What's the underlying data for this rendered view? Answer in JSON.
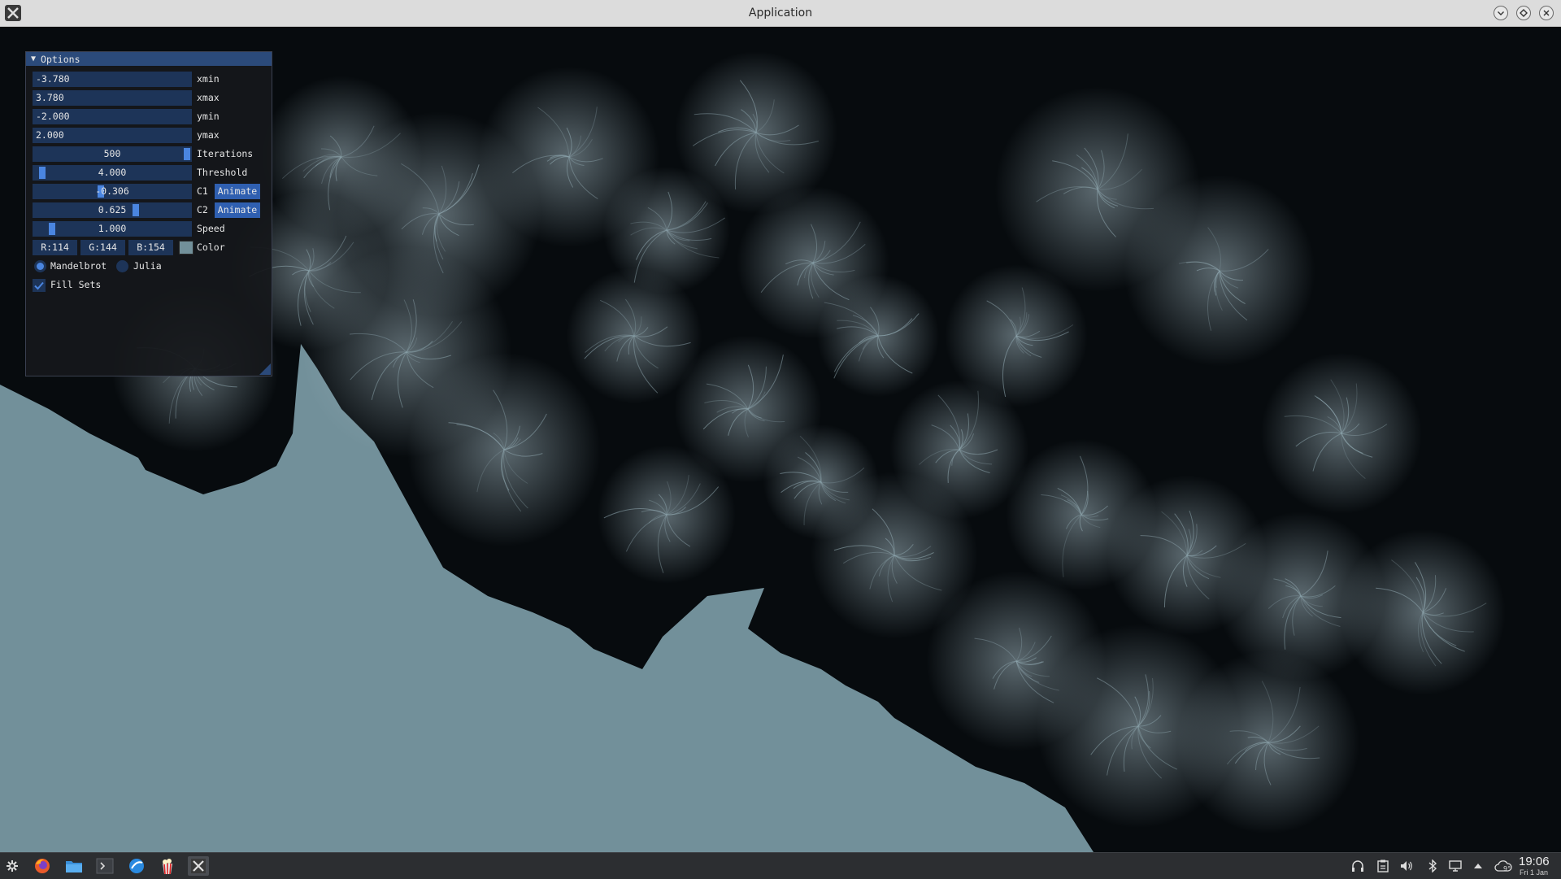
{
  "window": {
    "title": "Application"
  },
  "panel": {
    "title": "Options",
    "xmin": {
      "value": "-3.780",
      "label": "xmin"
    },
    "xmax": {
      "value": "3.780",
      "label": "xmax"
    },
    "ymin": {
      "value": "-2.000",
      "label": "ymin"
    },
    "ymax": {
      "value": "2.000",
      "label": "ymax"
    },
    "iterations": {
      "value": "500",
      "label": "Iterations"
    },
    "threshold": {
      "value": "4.000",
      "label": "Threshold"
    },
    "c1": {
      "value": "-0.306",
      "label": "C1",
      "animate_label": "Animate"
    },
    "c2": {
      "value": "0.625",
      "label": "C2",
      "animate_label": "Animate"
    },
    "speed": {
      "value": "1.000",
      "label": "Speed"
    },
    "color": {
      "r": "R:114",
      "g": "G:144",
      "b": "B:154",
      "label": "Color",
      "swatch": "#72909a"
    },
    "mode": {
      "options": [
        "Mandelbrot",
        "Julia"
      ],
      "selected": "Mandelbrot"
    },
    "fill_sets": {
      "label": "Fill Sets",
      "checked": true
    }
  },
  "taskbar": {
    "apps": [
      "app-launcher-icon",
      "firefox-icon",
      "file-manager-icon",
      "terminal-icon",
      "browser-icon",
      "popcorn-icon",
      "application-icon"
    ],
    "tray": [
      "headphones-icon",
      "clipboard-icon",
      "volume-icon",
      "bluetooth-icon",
      "display-icon",
      "tray-expand-icon",
      "weather-icon"
    ],
    "weather_temp": "9°",
    "clock_time": "19:06",
    "clock_date": "Fri 1 Jan"
  },
  "colors": {
    "fill": "#72909a",
    "panel_header": "#2b4a7a",
    "frame": "#1d3458",
    "accent": "#4a85e0"
  }
}
